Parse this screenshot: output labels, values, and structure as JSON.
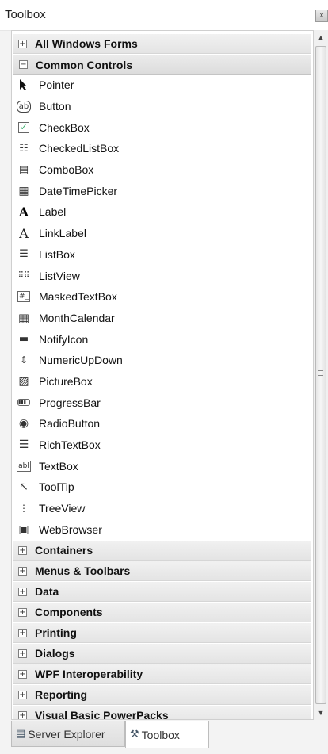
{
  "window": {
    "title": "Toolbox",
    "close_icon": "close-icon"
  },
  "categories_top": [
    {
      "label": "All Windows Forms",
      "toggle": "⊞",
      "expanded": false
    },
    {
      "label": "Common Controls",
      "toggle": "⊟",
      "expanded": true
    }
  ],
  "items": [
    {
      "label": "Pointer",
      "icon": "pointer-icon"
    },
    {
      "label": "Button",
      "icon": "button-icon"
    },
    {
      "label": "CheckBox",
      "icon": "checkbox-icon"
    },
    {
      "label": "CheckedListBox",
      "icon": "checkedlistbox-icon"
    },
    {
      "label": "ComboBox",
      "icon": "combobox-icon"
    },
    {
      "label": "DateTimePicker",
      "icon": "datetimepicker-icon"
    },
    {
      "label": "Label",
      "icon": "label-icon"
    },
    {
      "label": "LinkLabel",
      "icon": "linklabel-icon"
    },
    {
      "label": "ListBox",
      "icon": "listbox-icon"
    },
    {
      "label": "ListView",
      "icon": "listview-icon"
    },
    {
      "label": "MaskedTextBox",
      "icon": "maskedtextbox-icon"
    },
    {
      "label": "MonthCalendar",
      "icon": "monthcalendar-icon"
    },
    {
      "label": "NotifyIcon",
      "icon": "notifyicon-icon"
    },
    {
      "label": "NumericUpDown",
      "icon": "numericupdown-icon"
    },
    {
      "label": "PictureBox",
      "icon": "picturebox-icon"
    },
    {
      "label": "ProgressBar",
      "icon": "progressbar-icon"
    },
    {
      "label": "RadioButton",
      "icon": "radiobutton-icon"
    },
    {
      "label": "RichTextBox",
      "icon": "richtextbox-icon"
    },
    {
      "label": "TextBox",
      "icon": "textbox-icon"
    },
    {
      "label": "ToolTip",
      "icon": "tooltip-icon"
    },
    {
      "label": "TreeView",
      "icon": "treeview-icon"
    },
    {
      "label": "WebBrowser",
      "icon": "webbrowser-icon"
    }
  ],
  "categories_bottom": [
    {
      "label": "Containers",
      "toggle": "⊞"
    },
    {
      "label": "Menus & Toolbars",
      "toggle": "⊞"
    },
    {
      "label": "Data",
      "toggle": "⊞"
    },
    {
      "label": "Components",
      "toggle": "⊞"
    },
    {
      "label": "Printing",
      "toggle": "⊞"
    },
    {
      "label": "Dialogs",
      "toggle": "⊞"
    },
    {
      "label": "WPF Interoperability",
      "toggle": "⊞"
    },
    {
      "label": "Reporting",
      "toggle": "⊞"
    },
    {
      "label": "Visual Basic PowerPacks",
      "toggle": "⊞"
    }
  ],
  "tabs": [
    {
      "label": "Server Explorer",
      "icon": "server-explorer-icon",
      "active": false
    },
    {
      "label": "Toolbox",
      "icon": "toolbox-icon",
      "active": true
    }
  ]
}
